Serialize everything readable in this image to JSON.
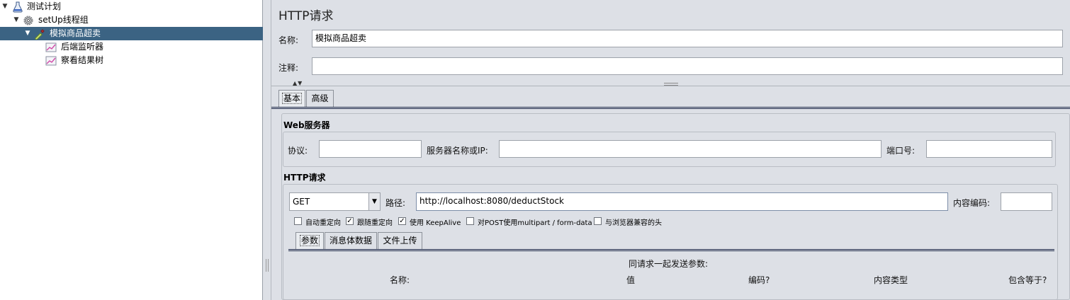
{
  "tree": {
    "items": [
      {
        "label": "测试计划",
        "icon": "test-plan-flask-icon"
      },
      {
        "label": "setUp线程组",
        "icon": "gear-icon"
      },
      {
        "label": "模拟商品超卖",
        "icon": "pipette-sampler-icon"
      },
      {
        "label": "后端监听器",
        "icon": "chart-listener-icon"
      },
      {
        "label": "察看结果树",
        "icon": "chart-listener-icon"
      }
    ]
  },
  "panel": {
    "title": "HTTP请求",
    "name_label": "名称:",
    "name_value": "模拟商品超卖",
    "comment_label": "注释:",
    "comment_value": ""
  },
  "tabs": [
    {
      "label": "基本"
    },
    {
      "label": "高级"
    }
  ],
  "web_server": {
    "title": "Web服务器",
    "protocol_label": "协议:",
    "protocol_value": "",
    "server_label": "服务器名称或IP:",
    "server_value": "",
    "port_label": "端口号:",
    "port_value": ""
  },
  "http_request": {
    "title": "HTTP请求",
    "method": "GET",
    "path_label": "路径:",
    "path_value": "http://localhost:8080/deductStock",
    "encoding_label": "内容编码:",
    "encoding_value": "",
    "options": [
      {
        "label": "自动重定向",
        "checked": false
      },
      {
        "label": "跟随重定向",
        "checked": true
      },
      {
        "label": "使用 KeepAlive",
        "checked": true
      },
      {
        "label": "对POST使用multipart / form-data",
        "checked": false
      },
      {
        "label": "与浏览器兼容的头",
        "checked": false
      }
    ]
  },
  "sub_tabs": [
    {
      "label": "参数"
    },
    {
      "label": "消息体数据"
    },
    {
      "label": "文件上传"
    }
  ],
  "params": {
    "caption": "同请求一起发送参数:",
    "columns": [
      "名称:",
      "值",
      "编码?",
      "内容类型",
      "包含等于?"
    ]
  },
  "colors": {
    "selection": "#3b6383",
    "panel_bg": "#dde0e6"
  }
}
